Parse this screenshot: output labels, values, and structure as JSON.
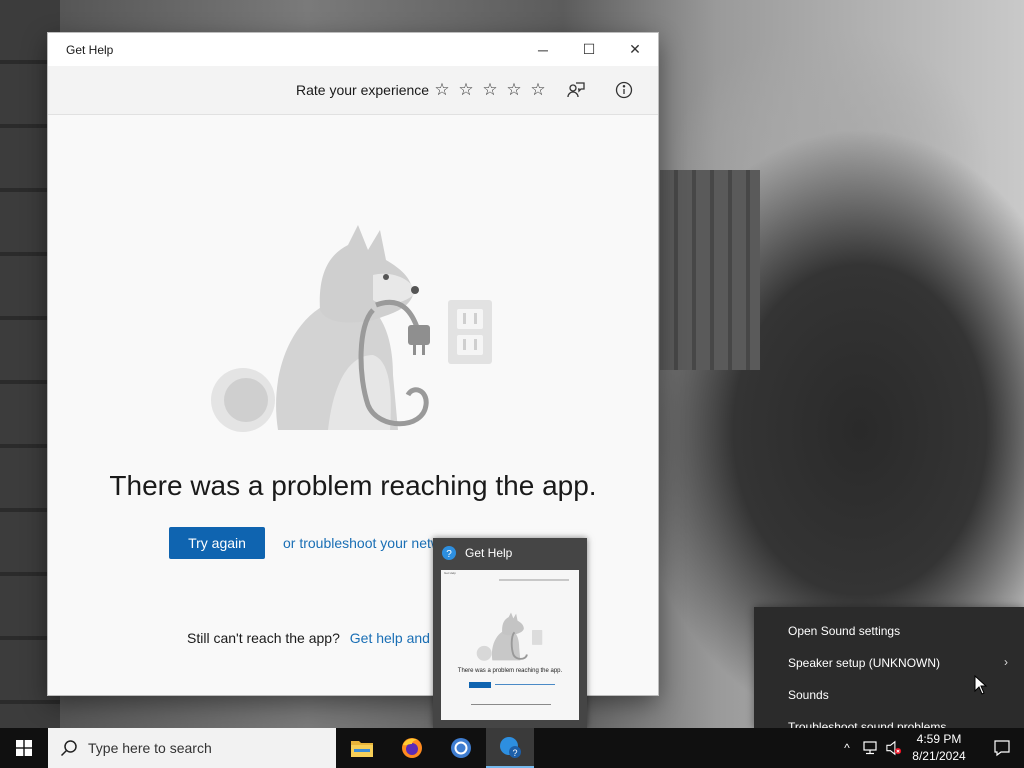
{
  "window": {
    "title": "Get Help",
    "minimize_glyph": "─",
    "maximize_glyph": "☐",
    "close_glyph": "✕"
  },
  "toolbar": {
    "rate_label": "Rate your experience",
    "stars": [
      "☆",
      "☆",
      "☆",
      "☆",
      "☆"
    ],
    "feedback_icon": "feedback-person-icon",
    "info_icon": "info-icon"
  },
  "content": {
    "headline": "There was a problem reaching the app.",
    "try_again_label": "Try again",
    "troubleshoot_link": "or troubleshoot your network connection",
    "still_text": "Still can't reach the app?",
    "get_help_link": "Get help and support"
  },
  "thumbnail": {
    "title": "Get Help",
    "mini_title": "Get Help",
    "mini_headline": "There was a problem reaching the app."
  },
  "context_menu": {
    "items": [
      "Open Sound settings",
      "Speaker setup (UNKNOWN)",
      "Sounds",
      "Troubleshoot sound problems"
    ],
    "submenu_arrow": "›"
  },
  "taskbar": {
    "search_placeholder": "Type here to search",
    "apps": [
      "file-explorer-icon",
      "firefox-icon",
      "chrome-icon",
      "get-help-icon"
    ],
    "tray_chevron": "^",
    "time": "4:59 PM",
    "date": "8/21/2024"
  },
  "colors": {
    "accent": "#0f64b0",
    "link": "#1a6fb5",
    "taskbar": "#101010",
    "menu": "#2b2b2b"
  }
}
